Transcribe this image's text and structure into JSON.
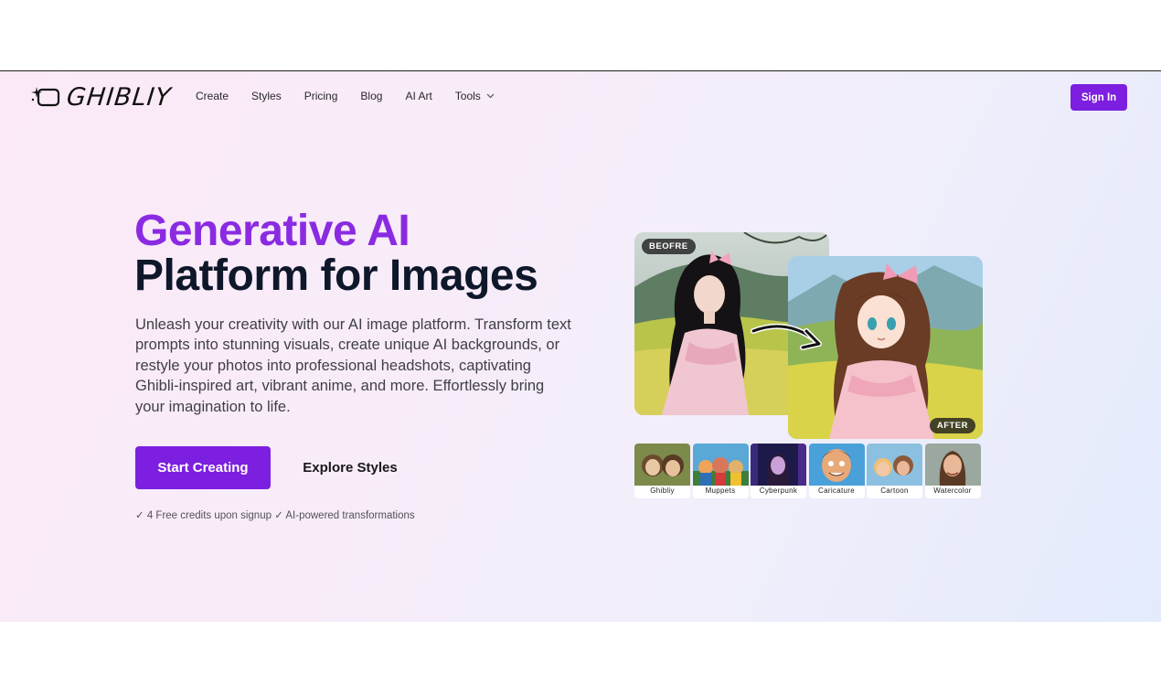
{
  "brand": {
    "name": "GHIBLIY"
  },
  "nav": {
    "items": [
      {
        "label": "Create"
      },
      {
        "label": "Styles"
      },
      {
        "label": "Pricing"
      },
      {
        "label": "Blog"
      },
      {
        "label": "AI Art"
      },
      {
        "label": "Tools"
      }
    ]
  },
  "header": {
    "signin_label": "Sign In"
  },
  "hero": {
    "title_line1": "Generative AI",
    "title_line2": "Platform for Images",
    "description": "Unleash your creativity with our AI image platform. Transform text prompts into stunning visuals, create unique AI backgrounds, or restyle your photos into professional headshots, captivating Ghibli-inspired art, vibrant anime, and more. Effortlessly bring your imagination to life.",
    "primary_cta": "Start Creating",
    "secondary_cta": "Explore Styles",
    "perks": "✓ 4 Free credits upon signup ✓ AI-powered transformations"
  },
  "showcase": {
    "before_label": "BEOFRE",
    "after_label": "AFTER",
    "styles": [
      {
        "label": "Ghibliy"
      },
      {
        "label": "Muppets"
      },
      {
        "label": "Cyberpunk"
      },
      {
        "label": "Caricature"
      },
      {
        "label": "Cartoon"
      },
      {
        "label": "Watercolor"
      }
    ]
  },
  "colors": {
    "accent": "#7c1fe0",
    "title_accent": "#8a2be2",
    "title_dark": "#0f172a"
  }
}
